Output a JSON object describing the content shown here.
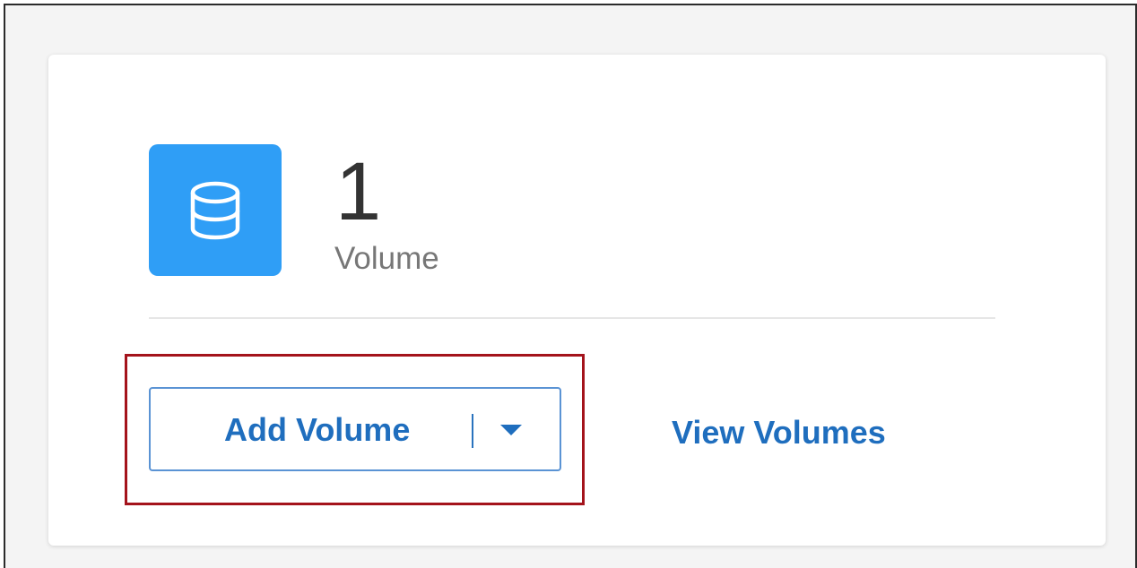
{
  "volumes_card": {
    "count": "1",
    "count_label": "Volume",
    "icon": "database-icon",
    "add_button": {
      "label": "Add Volume",
      "dropdown_icon": "caret-down-icon"
    },
    "view_link": "View Volumes"
  },
  "colors": {
    "accent_blue": "#2f9ef6",
    "link_blue": "#1f6ebe",
    "highlight_red": "#a4131c"
  }
}
